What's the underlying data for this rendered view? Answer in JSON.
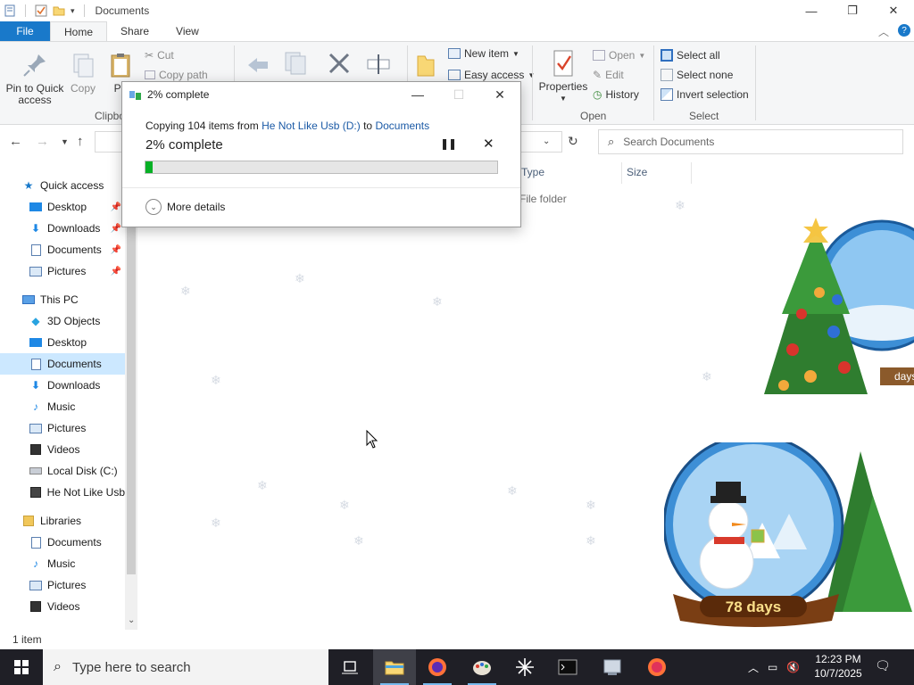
{
  "window": {
    "title": "Documents",
    "controls": {
      "minimize": "—",
      "maximize": "❐",
      "close": "✕"
    }
  },
  "ribbon_tabs": {
    "file": "File",
    "home": "Home",
    "share": "Share",
    "view": "View"
  },
  "ribbon": {
    "pin_to_quick_access": "Pin to Quick access",
    "copy": "Copy",
    "paste": "Pa",
    "cut": "Cut",
    "copy_path": "Copy path",
    "clipboard_group": "Clipbo",
    "new_item": "New item",
    "easy_access": "Easy access",
    "properties": "Properties",
    "open": "Open",
    "edit": "Edit",
    "history": "History",
    "open_group": "Open",
    "select_all": "Select all",
    "select_none": "Select none",
    "invert_selection": "Invert selection",
    "select_group": "Select"
  },
  "search": {
    "placeholder": "Search Documents"
  },
  "columns": {
    "type": "Type",
    "size": "Size"
  },
  "file_rows": [
    {
      "type": "File folder"
    }
  ],
  "nav": {
    "quick_access": "Quick access",
    "qa_items": [
      "Desktop",
      "Downloads",
      "Documents",
      "Pictures"
    ],
    "this_pc": "This PC",
    "pc_items": [
      "3D Objects",
      "Desktop",
      "Documents",
      "Downloads",
      "Music",
      "Pictures",
      "Videos",
      "Local Disk (C:)",
      "He Not Like Usb"
    ],
    "libraries": "Libraries",
    "lib_items": [
      "Documents",
      "Music",
      "Pictures",
      "Videos"
    ]
  },
  "status": {
    "items": "1 item"
  },
  "dialog": {
    "title": "2% complete",
    "copy_prefix": "Copying 104 items from ",
    "source": "He Not Like Usb (D:)",
    "to_word": " to ",
    "destination": "Documents",
    "percent_text": "2% complete",
    "progress": 0.02,
    "more_details": "More details"
  },
  "desktop_art": {
    "days_small": "days",
    "days_large": "78 days"
  },
  "taskbar": {
    "search_placeholder": "Type here to search",
    "time": "12:23 PM",
    "date": "10/7/2025"
  },
  "colors": {
    "accent": "#1979ca",
    "progress": "#06b025",
    "taskbar": "#1f1f26",
    "selected": "#cce8ff"
  }
}
